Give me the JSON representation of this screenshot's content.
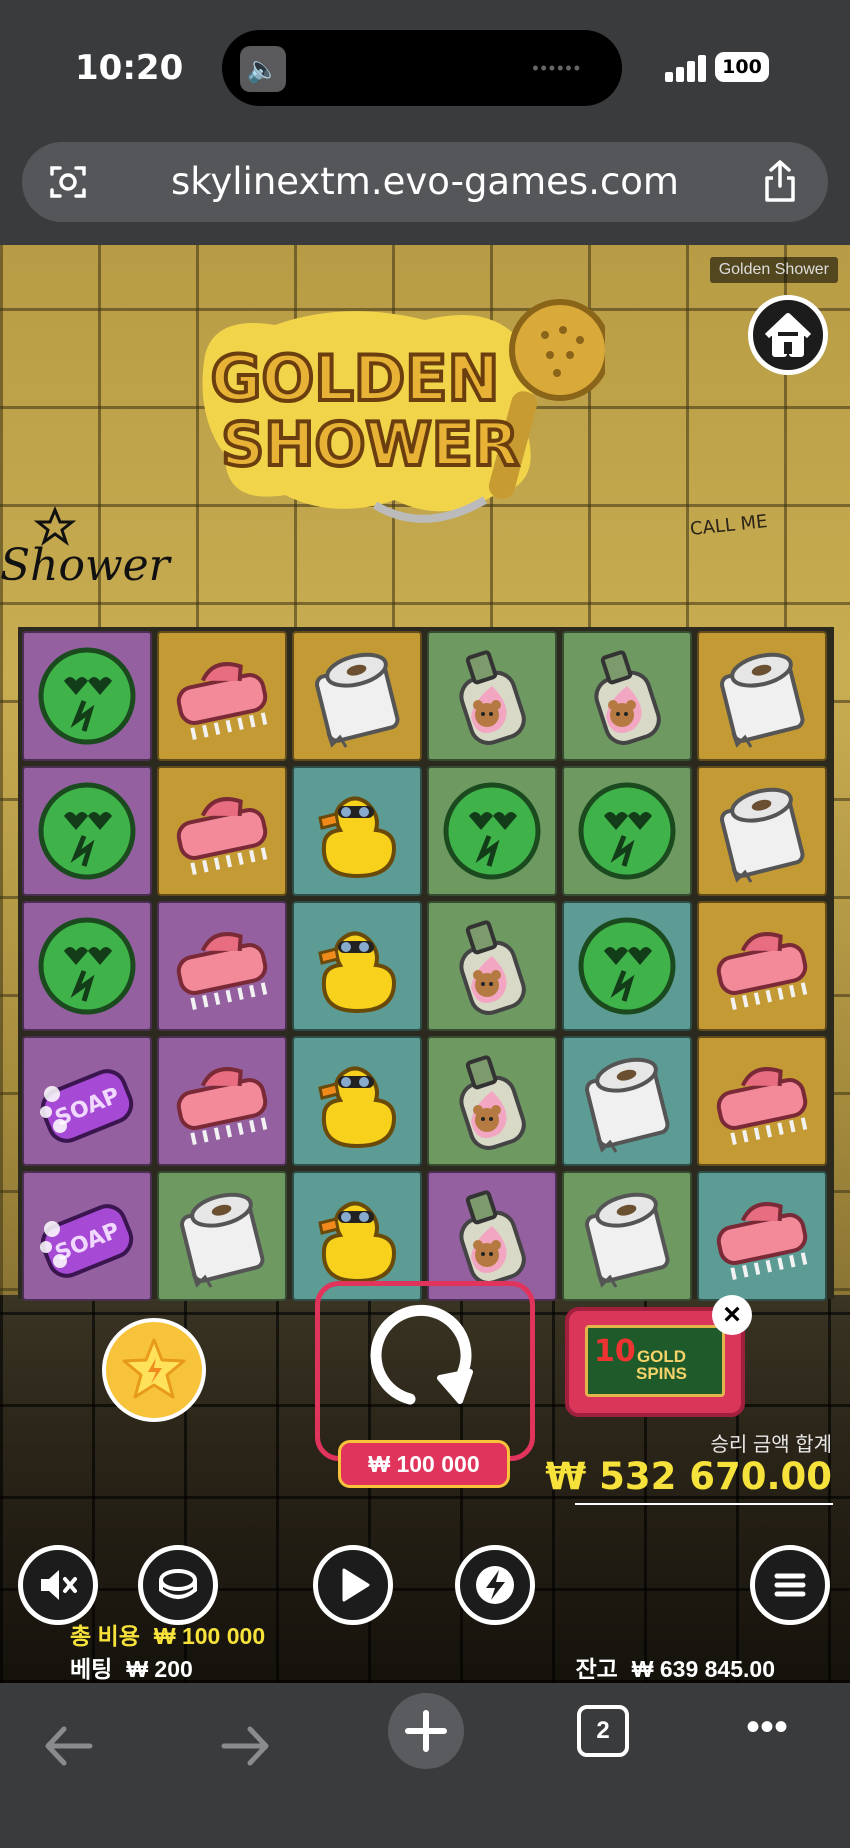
{
  "status_bar": {
    "time": "10:20",
    "battery": "100"
  },
  "browser": {
    "url": "skylinextm.evo-games.com",
    "tab_count": "2"
  },
  "game": {
    "tag": "Golden Shower",
    "logo_line1": "GOLDEN",
    "logo_line2": "SHOWER",
    "graffiti_text": "Shower",
    "wall_text": "CALL ME",
    "grid": [
      [
        {
          "symbol": "green-disc",
          "bg": "purple"
        },
        {
          "symbol": "scrub-brush",
          "bg": "gold"
        },
        {
          "symbol": "toilet-roll",
          "bg": "gold"
        },
        {
          "symbol": "bear-bottle",
          "bg": "green"
        },
        {
          "symbol": "bear-bottle",
          "bg": "green"
        },
        {
          "symbol": "toilet-roll",
          "bg": "gold"
        }
      ],
      [
        {
          "symbol": "green-disc",
          "bg": "purple"
        },
        {
          "symbol": "scrub-brush",
          "bg": "gold"
        },
        {
          "symbol": "rubber-duck",
          "bg": "teal"
        },
        {
          "symbol": "green-disc",
          "bg": "green"
        },
        {
          "symbol": "green-disc",
          "bg": "green"
        },
        {
          "symbol": "toilet-roll",
          "bg": "gold"
        }
      ],
      [
        {
          "symbol": "green-disc",
          "bg": "purple"
        },
        {
          "symbol": "scrub-brush",
          "bg": "purple"
        },
        {
          "symbol": "rubber-duck",
          "bg": "teal"
        },
        {
          "symbol": "bear-bottle",
          "bg": "green"
        },
        {
          "symbol": "green-disc",
          "bg": "teal"
        },
        {
          "symbol": "scrub-brush",
          "bg": "gold"
        }
      ],
      [
        {
          "symbol": "soap",
          "bg": "purple"
        },
        {
          "symbol": "scrub-brush",
          "bg": "purple"
        },
        {
          "symbol": "rubber-duck",
          "bg": "teal"
        },
        {
          "symbol": "bear-bottle",
          "bg": "green"
        },
        {
          "symbol": "toilet-roll",
          "bg": "teal"
        },
        {
          "symbol": "scrub-brush",
          "bg": "gold"
        }
      ],
      [
        {
          "symbol": "soap",
          "bg": "purple"
        },
        {
          "symbol": "toilet-roll",
          "bg": "green"
        },
        {
          "symbol": "rubber-duck",
          "bg": "teal"
        },
        {
          "symbol": "bear-bottle",
          "bg": "purple"
        },
        {
          "symbol": "toilet-roll",
          "bg": "green"
        },
        {
          "symbol": "scrub-brush",
          "bg": "teal"
        }
      ]
    ],
    "spin_bet": "₩ 100 000",
    "gold_spins": {
      "count": "10",
      "line1": "GOLD",
      "line2": "SPINS"
    },
    "win_label": "승리 금액 합계",
    "win_value": "₩ 532 670.00",
    "total_cost_label": "총 비용",
    "total_cost_value": "₩ 100 000",
    "bet_label": "베팅",
    "bet_value": "₩ 200",
    "balance_label": "잔고",
    "balance_value": "₩ 639 845.00"
  },
  "colors": {
    "accent_pink": "#e0345c",
    "win_yellow": "#f6e23a",
    "tile_purple": "#9460a0",
    "tile_gold": "#c49a34",
    "tile_teal": "#5c9c94",
    "tile_green": "#6e9a62"
  },
  "icons": [
    "camera-scan-icon",
    "share-icon",
    "home-icon",
    "star-icon",
    "spin-icon",
    "close-icon",
    "mute-icon",
    "coin-icon",
    "play-icon",
    "lightning-icon",
    "menu-icon",
    "back-icon",
    "forward-icon",
    "plus-icon",
    "more-icon"
  ]
}
